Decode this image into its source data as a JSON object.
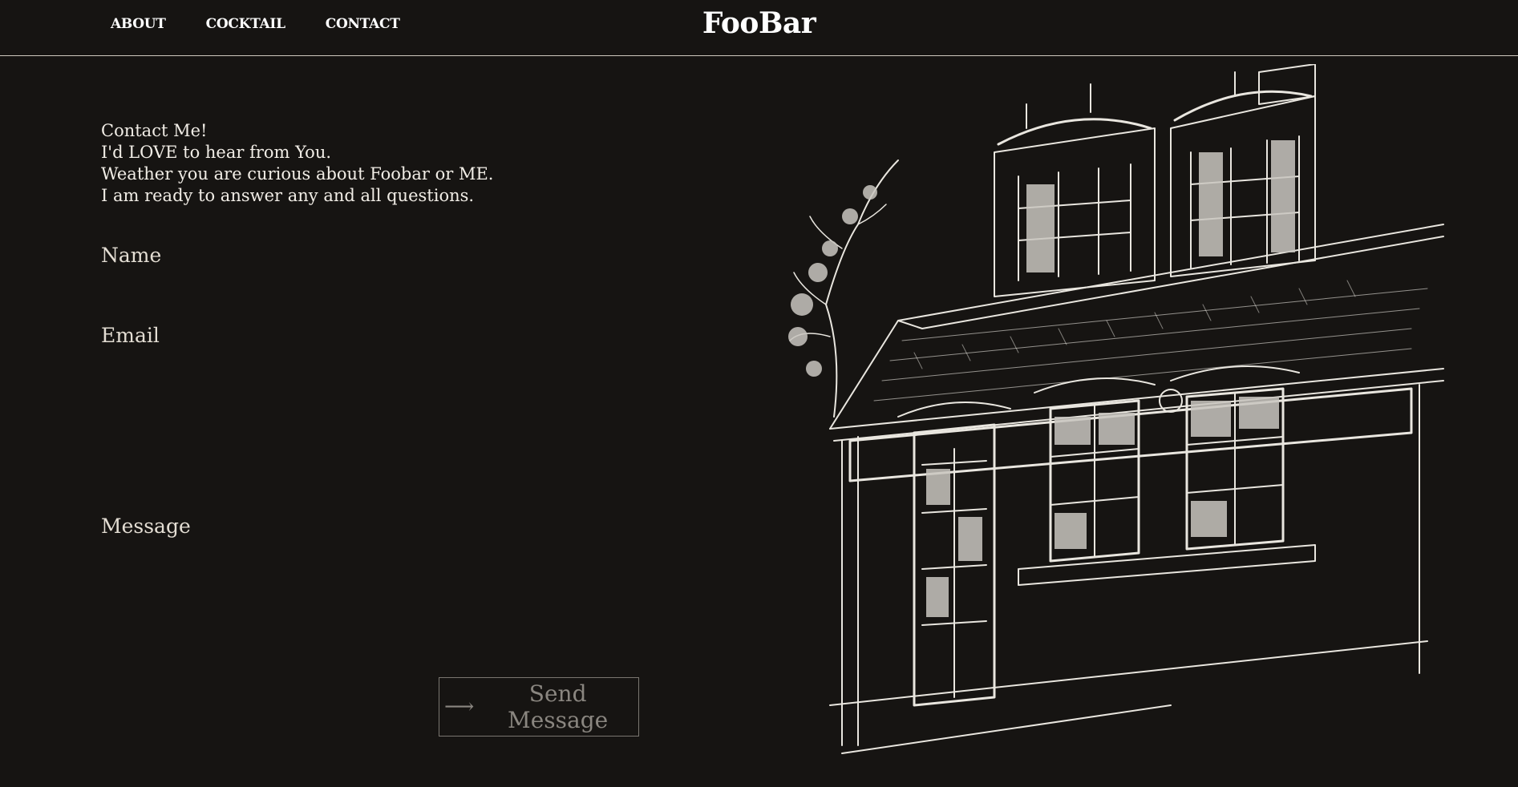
{
  "header": {
    "brand": "FooBar",
    "nav": [
      "ABOUT",
      "COCKTAIL",
      "CONTACT"
    ]
  },
  "intro": {
    "lines": [
      "Contact Me!",
      "I'd LOVE to hear from You.",
      "Weather you are curious about Foobar or ME.",
      "I am ready to answer any and all questions."
    ]
  },
  "form": {
    "name_label": "Name",
    "email_label": "Email",
    "message_label": "Message",
    "name_value": "",
    "email_value": "",
    "message_value": "",
    "send_label": "Send Message",
    "send_arrow": "⟶"
  },
  "illustration": {
    "subject": "building-sketch"
  },
  "colors": {
    "background": "#161412",
    "text": "#e6e2da",
    "border": "#cfc9bf",
    "button_text": "#8a8680"
  }
}
